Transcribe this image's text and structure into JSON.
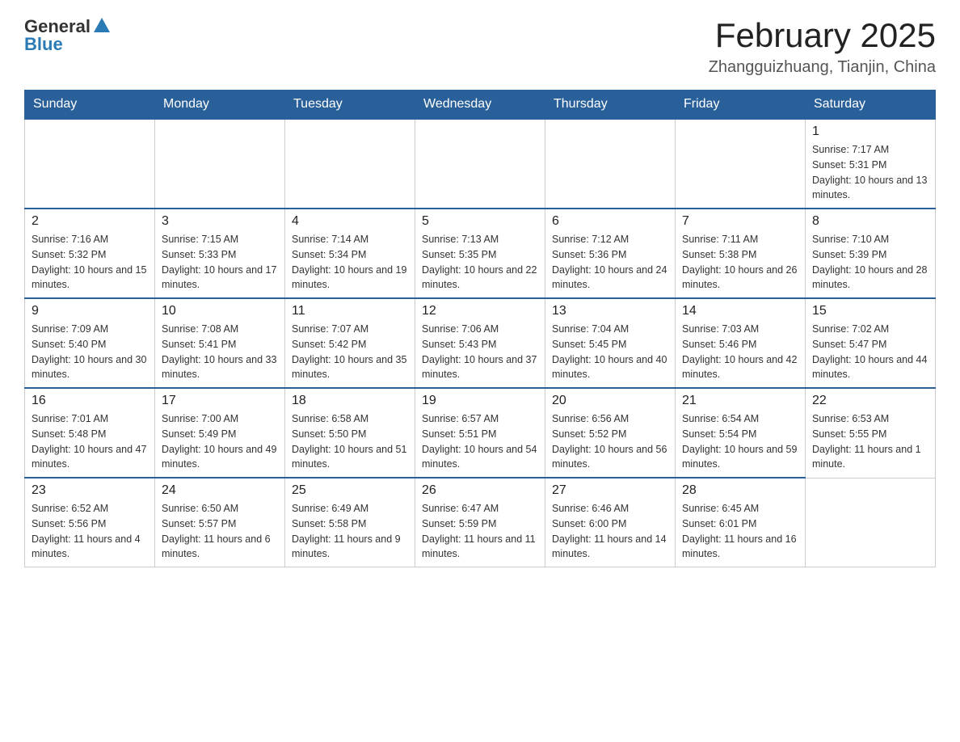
{
  "header": {
    "logo_general": "General",
    "logo_blue": "Blue",
    "month_title": "February 2025",
    "location": "Zhangguizhuang, Tianjin, China"
  },
  "days_of_week": [
    "Sunday",
    "Monday",
    "Tuesday",
    "Wednesday",
    "Thursday",
    "Friday",
    "Saturday"
  ],
  "weeks": [
    [
      {
        "day": "",
        "info": ""
      },
      {
        "day": "",
        "info": ""
      },
      {
        "day": "",
        "info": ""
      },
      {
        "day": "",
        "info": ""
      },
      {
        "day": "",
        "info": ""
      },
      {
        "day": "",
        "info": ""
      },
      {
        "day": "1",
        "info": "Sunrise: 7:17 AM\nSunset: 5:31 PM\nDaylight: 10 hours and 13 minutes."
      }
    ],
    [
      {
        "day": "2",
        "info": "Sunrise: 7:16 AM\nSunset: 5:32 PM\nDaylight: 10 hours and 15 minutes."
      },
      {
        "day": "3",
        "info": "Sunrise: 7:15 AM\nSunset: 5:33 PM\nDaylight: 10 hours and 17 minutes."
      },
      {
        "day": "4",
        "info": "Sunrise: 7:14 AM\nSunset: 5:34 PM\nDaylight: 10 hours and 19 minutes."
      },
      {
        "day": "5",
        "info": "Sunrise: 7:13 AM\nSunset: 5:35 PM\nDaylight: 10 hours and 22 minutes."
      },
      {
        "day": "6",
        "info": "Sunrise: 7:12 AM\nSunset: 5:36 PM\nDaylight: 10 hours and 24 minutes."
      },
      {
        "day": "7",
        "info": "Sunrise: 7:11 AM\nSunset: 5:38 PM\nDaylight: 10 hours and 26 minutes."
      },
      {
        "day": "8",
        "info": "Sunrise: 7:10 AM\nSunset: 5:39 PM\nDaylight: 10 hours and 28 minutes."
      }
    ],
    [
      {
        "day": "9",
        "info": "Sunrise: 7:09 AM\nSunset: 5:40 PM\nDaylight: 10 hours and 30 minutes."
      },
      {
        "day": "10",
        "info": "Sunrise: 7:08 AM\nSunset: 5:41 PM\nDaylight: 10 hours and 33 minutes."
      },
      {
        "day": "11",
        "info": "Sunrise: 7:07 AM\nSunset: 5:42 PM\nDaylight: 10 hours and 35 minutes."
      },
      {
        "day": "12",
        "info": "Sunrise: 7:06 AM\nSunset: 5:43 PM\nDaylight: 10 hours and 37 minutes."
      },
      {
        "day": "13",
        "info": "Sunrise: 7:04 AM\nSunset: 5:45 PM\nDaylight: 10 hours and 40 minutes."
      },
      {
        "day": "14",
        "info": "Sunrise: 7:03 AM\nSunset: 5:46 PM\nDaylight: 10 hours and 42 minutes."
      },
      {
        "day": "15",
        "info": "Sunrise: 7:02 AM\nSunset: 5:47 PM\nDaylight: 10 hours and 44 minutes."
      }
    ],
    [
      {
        "day": "16",
        "info": "Sunrise: 7:01 AM\nSunset: 5:48 PM\nDaylight: 10 hours and 47 minutes."
      },
      {
        "day": "17",
        "info": "Sunrise: 7:00 AM\nSunset: 5:49 PM\nDaylight: 10 hours and 49 minutes."
      },
      {
        "day": "18",
        "info": "Sunrise: 6:58 AM\nSunset: 5:50 PM\nDaylight: 10 hours and 51 minutes."
      },
      {
        "day": "19",
        "info": "Sunrise: 6:57 AM\nSunset: 5:51 PM\nDaylight: 10 hours and 54 minutes."
      },
      {
        "day": "20",
        "info": "Sunrise: 6:56 AM\nSunset: 5:52 PM\nDaylight: 10 hours and 56 minutes."
      },
      {
        "day": "21",
        "info": "Sunrise: 6:54 AM\nSunset: 5:54 PM\nDaylight: 10 hours and 59 minutes."
      },
      {
        "day": "22",
        "info": "Sunrise: 6:53 AM\nSunset: 5:55 PM\nDaylight: 11 hours and 1 minute."
      }
    ],
    [
      {
        "day": "23",
        "info": "Sunrise: 6:52 AM\nSunset: 5:56 PM\nDaylight: 11 hours and 4 minutes."
      },
      {
        "day": "24",
        "info": "Sunrise: 6:50 AM\nSunset: 5:57 PM\nDaylight: 11 hours and 6 minutes."
      },
      {
        "day": "25",
        "info": "Sunrise: 6:49 AM\nSunset: 5:58 PM\nDaylight: 11 hours and 9 minutes."
      },
      {
        "day": "26",
        "info": "Sunrise: 6:47 AM\nSunset: 5:59 PM\nDaylight: 11 hours and 11 minutes."
      },
      {
        "day": "27",
        "info": "Sunrise: 6:46 AM\nSunset: 6:00 PM\nDaylight: 11 hours and 14 minutes."
      },
      {
        "day": "28",
        "info": "Sunrise: 6:45 AM\nSunset: 6:01 PM\nDaylight: 11 hours and 16 minutes."
      },
      {
        "day": "",
        "info": ""
      }
    ]
  ]
}
